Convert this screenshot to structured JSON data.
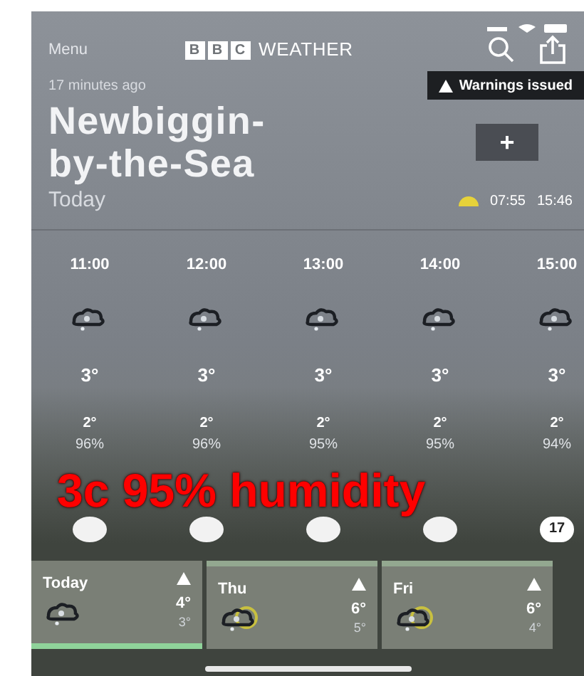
{
  "header": {
    "menu": "Menu",
    "logo_letters": [
      "B",
      "B",
      "C"
    ],
    "title": "WEATHER"
  },
  "location": {
    "updated": "17 minutes ago",
    "warning": "Warnings issued",
    "name_lines": [
      "Newbiggin-",
      "by-the-Sea"
    ],
    "day": "Today",
    "sunrise": "07:55",
    "sunset": "15:46",
    "add": "+"
  },
  "hours": [
    {
      "time": "11:00",
      "temp": "3°",
      "feels": "2°",
      "humidity": "96%"
    },
    {
      "time": "12:00",
      "temp": "3°",
      "feels": "2°",
      "humidity": "96%"
    },
    {
      "time": "13:00",
      "temp": "3°",
      "feels": "2°",
      "humidity": "95%"
    },
    {
      "time": "14:00",
      "temp": "3°",
      "feels": "2°",
      "humidity": "95%"
    },
    {
      "time": "15:00",
      "temp": "3°",
      "feels": "2°",
      "humidity": "94%",
      "wind": "17"
    }
  ],
  "caption": "3c 95% humidity",
  "days": [
    {
      "label": "Today",
      "high": "4°",
      "low": "3°",
      "selected": true,
      "sun": false
    },
    {
      "label": "Thu",
      "high": "6°",
      "low": "5°",
      "selected": false,
      "sun": true
    },
    {
      "label": "Fri",
      "high": "6°",
      "low": "4°",
      "selected": false,
      "sun": true
    }
  ]
}
